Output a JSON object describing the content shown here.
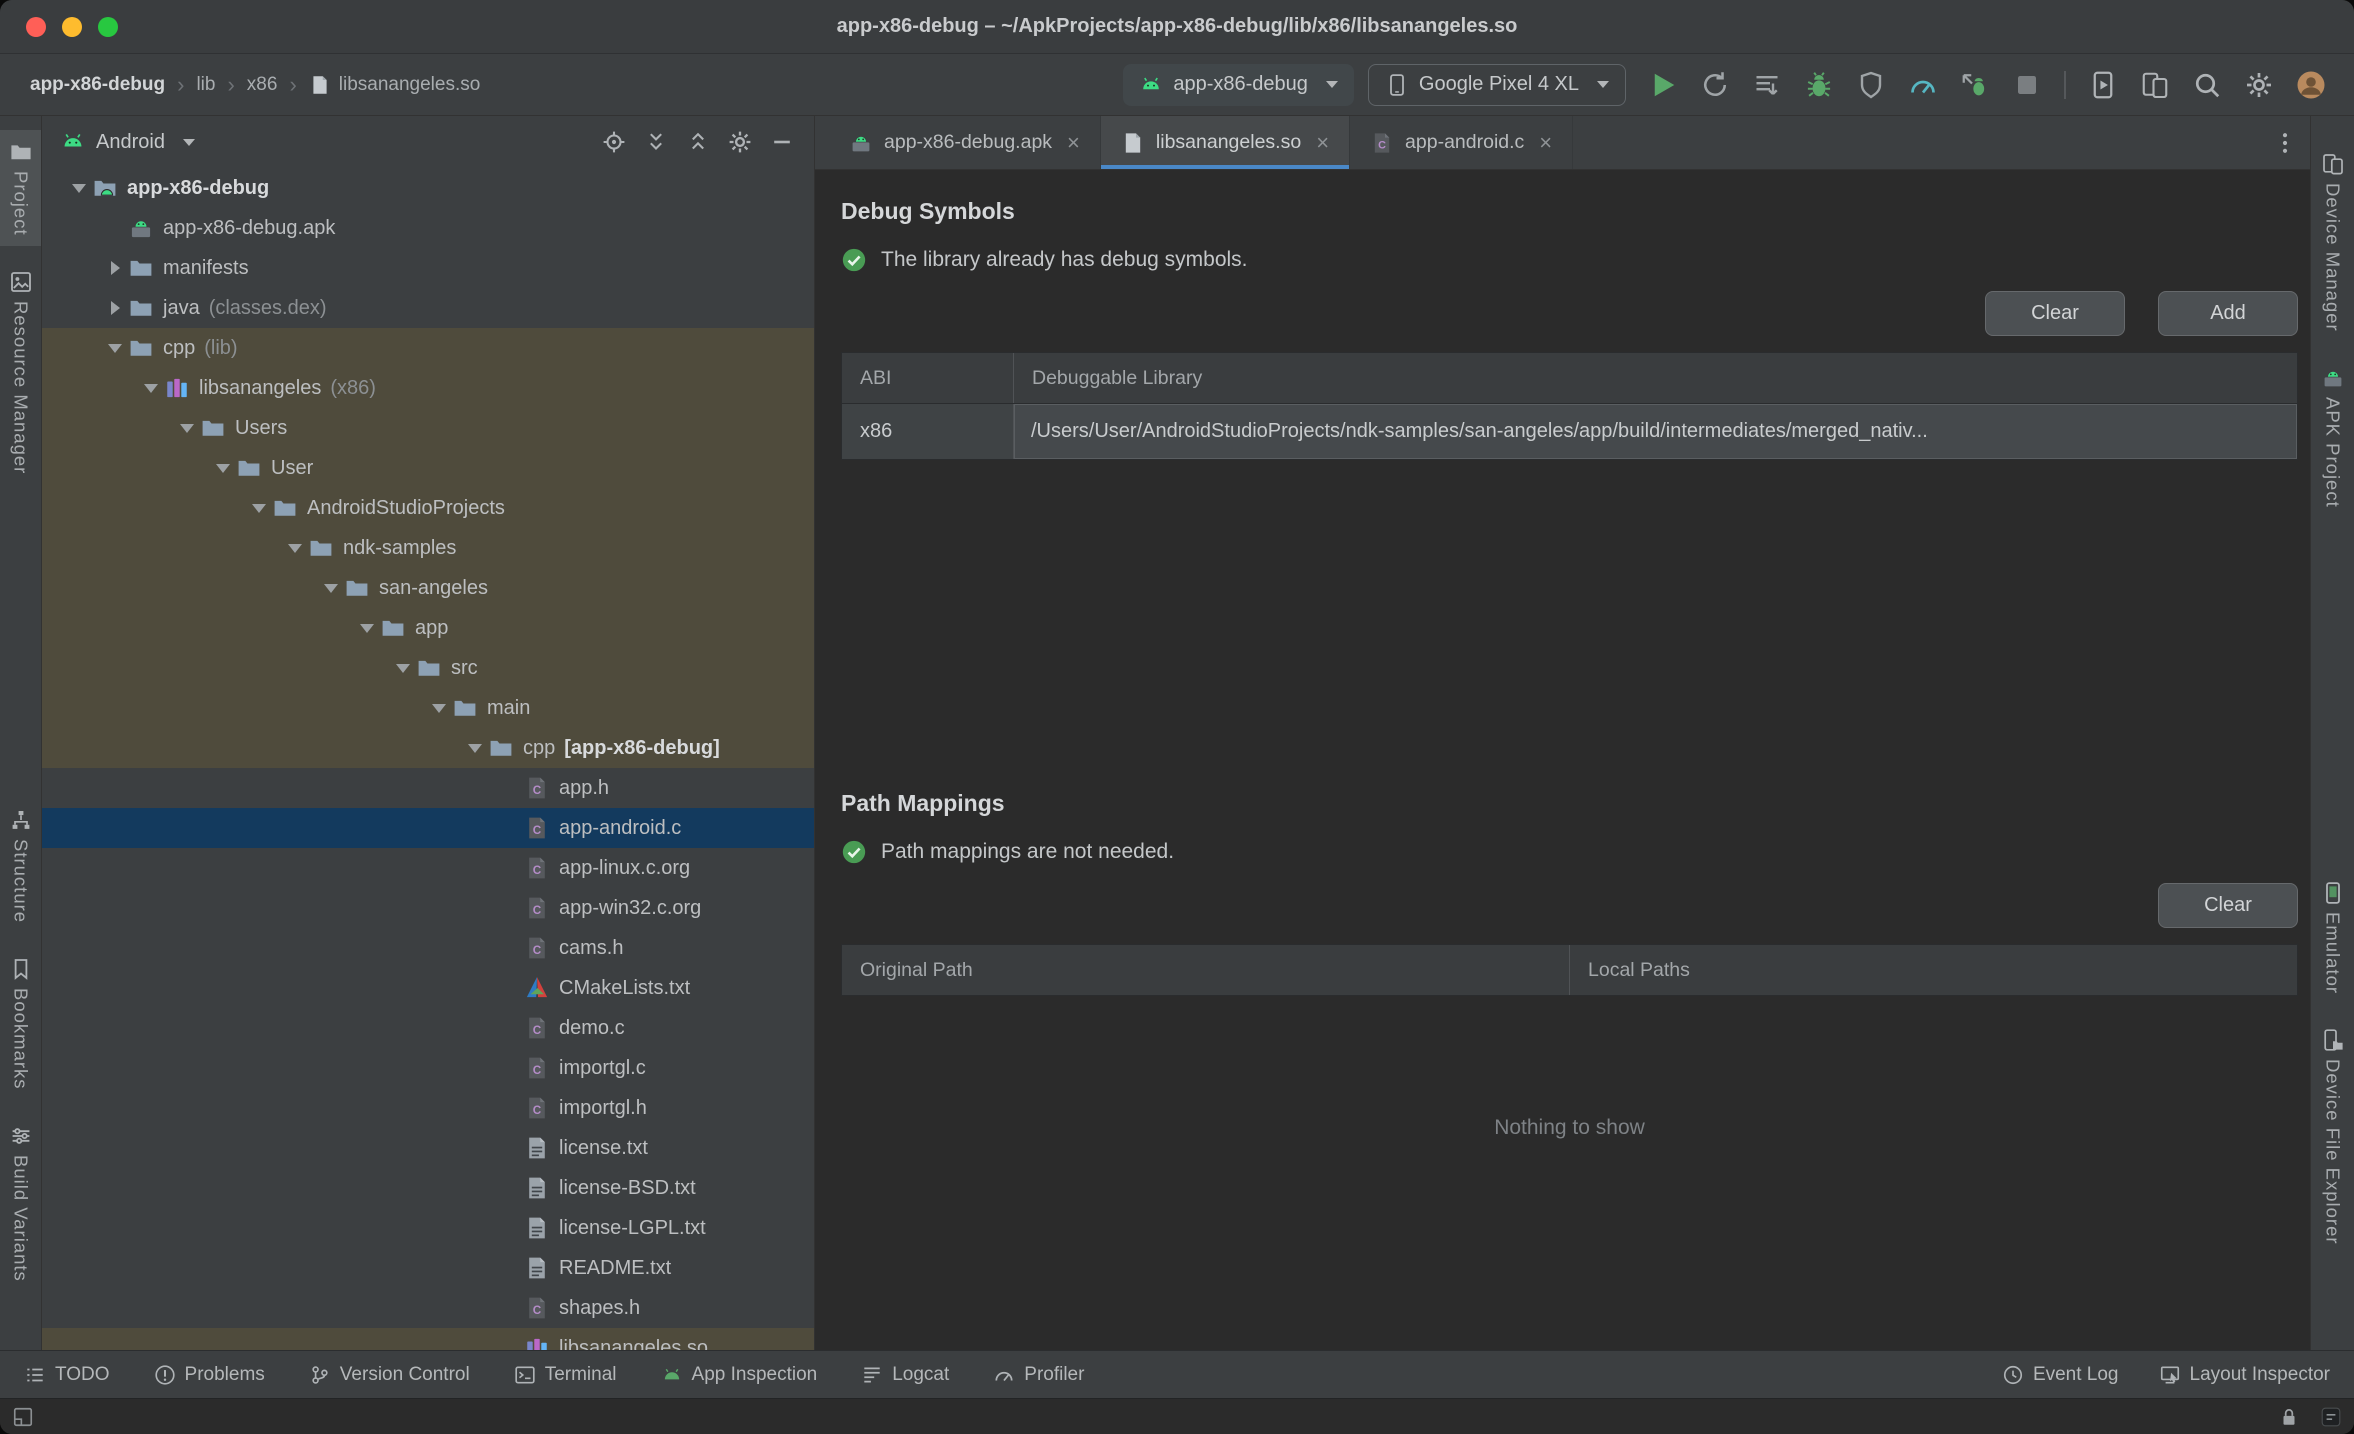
{
  "window": {
    "title": "app-x86-debug – ~/ApkProjects/app-x86-debug/lib/x86/libsanangeles.so"
  },
  "ui": {
    "breadcrumb_separator": "›",
    "tab_close": "×"
  },
  "colors": {
    "accent_blue": "#4A88C7",
    "selection_blue": "#133A5E",
    "path_highlight_tan": "#4F4B3C",
    "status_green": "#499C54",
    "run_green": "#59A869",
    "traffic_red": "#FF5F57",
    "traffic_yellow": "#FEBC2E",
    "traffic_green": "#28C840"
  },
  "header": {
    "breadcrumbs": [
      {
        "label": "app-x86-debug",
        "bold": true
      },
      {
        "label": "lib"
      },
      {
        "label": "x86"
      },
      {
        "label": "libsanangeles.so",
        "icon": "file"
      }
    ],
    "run_config": {
      "label": "app-x86-debug",
      "icon": "android"
    },
    "device_selector": {
      "label": "Google Pixel 4 XL",
      "icon": "phone"
    },
    "actions": [
      "run",
      "apply-changes",
      "apply-code-changes",
      "debug",
      "profile-app",
      "profiler",
      "attach-debugger",
      "stop",
      "divider",
      "device-mirror",
      "device-manager",
      "search",
      "settings",
      "avatar"
    ]
  },
  "left_stripe": {
    "primary": [
      {
        "label": "Project",
        "icon": "project",
        "active": true
      },
      {
        "label": "Resource Manager",
        "icon": "resource-manager"
      }
    ],
    "secondary": [
      {
        "label": "Structure",
        "icon": "structure"
      },
      {
        "label": "Bookmarks",
        "icon": "bookmarks"
      },
      {
        "label": "Build Variants",
        "icon": "build-variants"
      }
    ]
  },
  "right_stripe": {
    "primary": [
      {
        "label": "Device Manager",
        "icon": "device-manager"
      },
      {
        "label": "APK Project",
        "icon": "apk"
      }
    ],
    "secondary": [
      {
        "label": "Emulator",
        "icon": "emulator"
      },
      {
        "label": "Device File Explorer",
        "icon": "device-file-explorer"
      }
    ]
  },
  "project_panel": {
    "view_selector": "Android",
    "selector_icon": "android",
    "actions": [
      "locate",
      "expand-all",
      "collapse-all",
      "settings",
      "hide"
    ],
    "tree": [
      {
        "label": "app-x86-debug",
        "level": 0,
        "icon": "android-module",
        "chevron": "down",
        "bold": true
      },
      {
        "label": "app-x86-debug.apk",
        "level": 1,
        "icon": "apk"
      },
      {
        "label": "manifests",
        "level": 1,
        "icon": "folder",
        "chevron": "right"
      },
      {
        "label": "java",
        "suffix": "(classes.dex)",
        "level": 1,
        "icon": "folder",
        "chevron": "right"
      },
      {
        "label": "cpp",
        "suffix": "(lib)",
        "level": 1,
        "icon": "folder",
        "chevron": "down",
        "highlight": "path"
      },
      {
        "label": "libsanangeles",
        "suffix": "(x86)",
        "level": 2,
        "icon": "library",
        "chevron": "down",
        "highlight": "path"
      },
      {
        "label": "Users",
        "level": 3,
        "icon": "folder",
        "chevron": "down",
        "highlight": "path"
      },
      {
        "label": "User",
        "level": 4,
        "icon": "folder",
        "chevron": "down",
        "highlight": "path"
      },
      {
        "label": "AndroidStudioProjects",
        "level": 5,
        "icon": "folder",
        "chevron": "down",
        "highlight": "path"
      },
      {
        "label": "ndk-samples",
        "level": 6,
        "icon": "folder",
        "chevron": "down",
        "highlight": "path"
      },
      {
        "label": "san-angeles",
        "level": 7,
        "icon": "folder",
        "chevron": "down",
        "highlight": "path"
      },
      {
        "label": "app",
        "level": 8,
        "icon": "folder",
        "chevron": "down",
        "highlight": "path"
      },
      {
        "label": "src",
        "level": 9,
        "icon": "folder",
        "chevron": "down",
        "highlight": "path"
      },
      {
        "label": "main",
        "level": 10,
        "icon": "folder",
        "chevron": "down",
        "highlight": "path"
      },
      {
        "label": "cpp",
        "suffix_bold": "[app-x86-debug]",
        "level": 11,
        "icon": "folder",
        "chevron": "down",
        "highlight": "path"
      },
      {
        "label": "app.h",
        "level": 12,
        "icon": "c-file"
      },
      {
        "label": "app-android.c",
        "level": 12,
        "icon": "c-file",
        "highlight": "selected"
      },
      {
        "label": "app-linux.c.org",
        "level": 12,
        "icon": "c-file"
      },
      {
        "label": "app-win32.c.org",
        "level": 12,
        "icon": "c-file"
      },
      {
        "label": "cams.h",
        "level": 12,
        "icon": "c-file"
      },
      {
        "label": "CMakeLists.txt",
        "level": 12,
        "icon": "cmake"
      },
      {
        "label": "demo.c",
        "level": 12,
        "icon": "c-file"
      },
      {
        "label": "importgl.c",
        "level": 12,
        "icon": "c-file"
      },
      {
        "label": "importgl.h",
        "level": 12,
        "icon": "c-file"
      },
      {
        "label": "license.txt",
        "level": 12,
        "icon": "text-file"
      },
      {
        "label": "license-BSD.txt",
        "level": 12,
        "icon": "text-file"
      },
      {
        "label": "license-LGPL.txt",
        "level": 12,
        "icon": "text-file"
      },
      {
        "label": "README.txt",
        "level": 12,
        "icon": "text-file"
      },
      {
        "label": "shapes.h",
        "level": 12,
        "icon": "c-file"
      },
      {
        "label": "libsanangeles.so",
        "level": 12,
        "icon": "library",
        "highlight": "path"
      }
    ]
  },
  "editor": {
    "overflow_icon": "kebab",
    "tabs": [
      {
        "label": "app-x86-debug.apk",
        "icon": "apk"
      },
      {
        "label": "libsanangeles.so",
        "icon": "file",
        "active": true
      },
      {
        "label": "app-android.c",
        "icon": "c-file"
      }
    ],
    "debug_symbols": {
      "title": "Debug Symbols",
      "status_icon": "check-circle",
      "status": "The library already has debug symbols.",
      "buttons": [
        "Clear",
        "Add"
      ],
      "table": {
        "columns": [
          "ABI",
          "Debuggable Library"
        ],
        "rows": [
          [
            "x86",
            "/Users/User/AndroidStudioProjects/ndk-samples/san-angeles/app/build/intermediates/merged_nativ..."
          ]
        ]
      }
    },
    "path_mappings": {
      "title": "Path Mappings",
      "status_icon": "check-circle",
      "status": "Path mappings are not needed.",
      "buttons": [
        "Clear"
      ],
      "table": {
        "columns": [
          "Original Path",
          "Local Paths"
        ],
        "rows": []
      },
      "empty_text": "Nothing to show"
    }
  },
  "status_bar": {
    "left": [
      {
        "label": "TODO",
        "icon": "todo"
      },
      {
        "label": "Problems",
        "icon": "problems"
      },
      {
        "label": "Version Control",
        "icon": "vcs"
      },
      {
        "label": "Terminal",
        "icon": "terminal"
      },
      {
        "label": "App Inspection",
        "icon": "app-inspection"
      },
      {
        "label": "Logcat",
        "icon": "logcat"
      },
      {
        "label": "Profiler",
        "icon": "profiler-small"
      }
    ],
    "right": [
      {
        "label": "Event Log",
        "icon": "event-log"
      },
      {
        "label": "Layout Inspector",
        "icon": "layout-inspector"
      }
    ]
  },
  "bottom_bar": {
    "left": [
      "toolwindow"
    ],
    "right": [
      "lock",
      "notifications"
    ]
  }
}
